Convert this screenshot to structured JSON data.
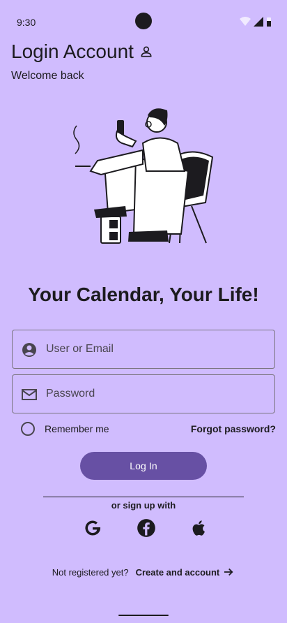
{
  "status": {
    "time": "9:30"
  },
  "header": {
    "title": "Login Account",
    "subtitle": "Welcome back"
  },
  "hero": {
    "headline": "Your Calendar, Your Life!"
  },
  "form": {
    "user_placeholder": "User or Email",
    "password_placeholder": "Password",
    "remember_label": "Remember me",
    "remember_checked": false,
    "forgot_label": "Forgot password?",
    "login_label": "Log In"
  },
  "social": {
    "label": "or sign up with",
    "providers": [
      "google-icon",
      "facebook-icon",
      "apple-icon"
    ]
  },
  "footer": {
    "prompt": "Not registered yet?",
    "create_label": "Create and account"
  },
  "colors": {
    "background": "#d0bcfe",
    "primary": "#6750a4",
    "text": "#1c1b1f"
  }
}
